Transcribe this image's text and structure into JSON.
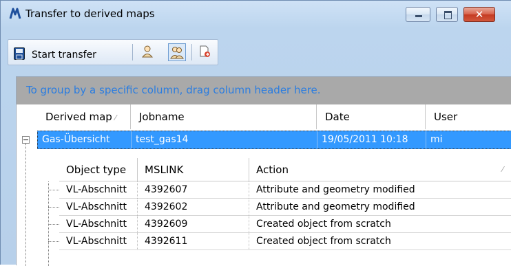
{
  "window": {
    "title": "Transfer to derived maps",
    "close_glyph": "✕"
  },
  "toolbar": {
    "start_transfer_label": "Start transfer",
    "icons": [
      "save-icon",
      "user-icon",
      "users-icon",
      "transfer-document-icon"
    ]
  },
  "grid": {
    "group_panel_hint": "To group by a specific column, drag column header here.",
    "columns": [
      "Derived map",
      "Jobname",
      "Date",
      "User"
    ],
    "sort_glyph": "⁄",
    "selected_row": {
      "derived_map": "Gas-Übersicht",
      "jobname": "test_gas14",
      "date": "19/05/2011 10:18",
      "user": "mi"
    },
    "detail": {
      "columns": [
        "Object type",
        "MSLINK",
        "Action"
      ],
      "rows": [
        {
          "object_type": "VL-Abschnitt",
          "mslink": "4392607",
          "action": "Attribute and geometry modified"
        },
        {
          "object_type": "VL-Abschnitt",
          "mslink": "4392602",
          "action": "Attribute and geometry modified"
        },
        {
          "object_type": "VL-Abschnitt",
          "mslink": "4392609",
          "action": "Created object from scratch"
        },
        {
          "object_type": "VL-Abschnitt",
          "mslink": "4392611",
          "action": "Created object from scratch"
        }
      ]
    }
  },
  "colors": {
    "selection": "#3399ff",
    "group_hint": "#2b7de0",
    "close_button": "#c43a22"
  }
}
